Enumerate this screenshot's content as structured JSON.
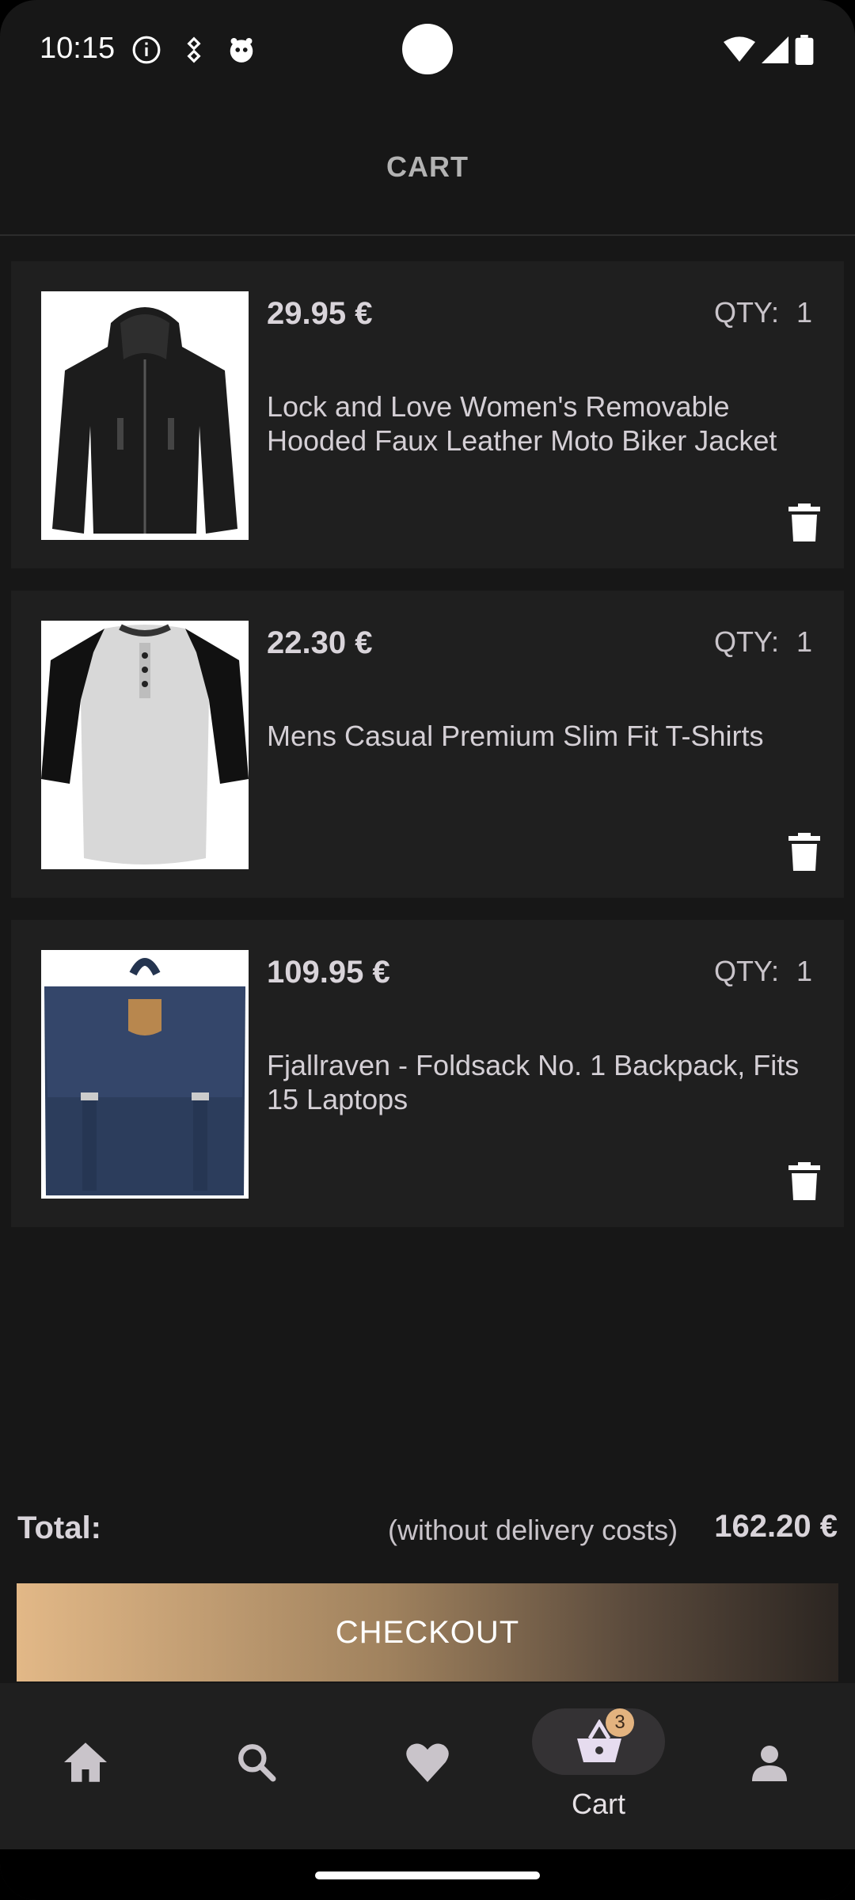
{
  "status": {
    "time": "10:15"
  },
  "header": {
    "title": "CART"
  },
  "items": [
    {
      "price": "29.95 €",
      "qty_label": "QTY:",
      "qty": "1",
      "title": "Lock and Love Women's Removable Hooded Faux Leather Moto Biker Jacket",
      "image": "black-leather-jacket"
    },
    {
      "price": "22.30 €",
      "qty_label": "QTY:",
      "qty": "1",
      "title": "Mens Casual Premium Slim Fit T-Shirts",
      "image": "raglan-henley-shirt"
    },
    {
      "price": "109.95 €",
      "qty_label": "QTY:",
      "qty": "1",
      "title": "Fjallraven - Foldsack No. 1 Backpack, Fits 15 Laptops",
      "image": "navy-backpack"
    }
  ],
  "total": {
    "label": "Total:",
    "note": "(without delivery costs)",
    "value": "162.20 €"
  },
  "checkout_label": "CHECKOUT",
  "nav": {
    "cart_label": "Cart",
    "cart_badge": "3",
    "active": "cart"
  },
  "colors": {
    "background": "#171717",
    "card": "#1f1f1f",
    "accent": "#e3b37f"
  }
}
